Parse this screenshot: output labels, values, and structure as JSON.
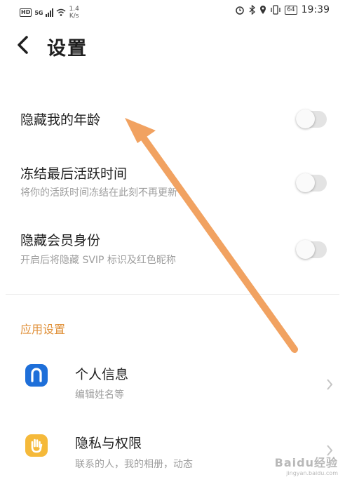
{
  "status_bar": {
    "hd": "HD",
    "network": "5G",
    "speed_value": "1.4",
    "speed_unit": "K/s",
    "battery": "64",
    "time": "19:39"
  },
  "header": {
    "title": "设置"
  },
  "settings": [
    {
      "title": "隐藏我的年龄",
      "subtitle": "",
      "enabled": false
    },
    {
      "title": "冻结最后活跃时间",
      "subtitle": "将你的活跃时间冻结在此刻不再更新",
      "enabled": false
    },
    {
      "title": "隐藏会员身份",
      "subtitle": "开启后将隐藏 SVIP 标识及红色昵称",
      "enabled": false
    }
  ],
  "section": {
    "title": "应用设置"
  },
  "app_items": [
    {
      "title": "个人信息",
      "subtitle": "编辑姓名等",
      "icon": "person-icon",
      "icon_color": "#1e6fd9"
    },
    {
      "title": "隐私与权限",
      "subtitle": "联系的人，我的相册，动态",
      "icon": "hand-icon",
      "icon_color": "#f5b93a"
    }
  ],
  "watermark": {
    "main": "Baidu经验",
    "sub": "jingyan.baidu.com"
  },
  "colors": {
    "accent": "#e0913a",
    "arrow": "#f1a261"
  }
}
